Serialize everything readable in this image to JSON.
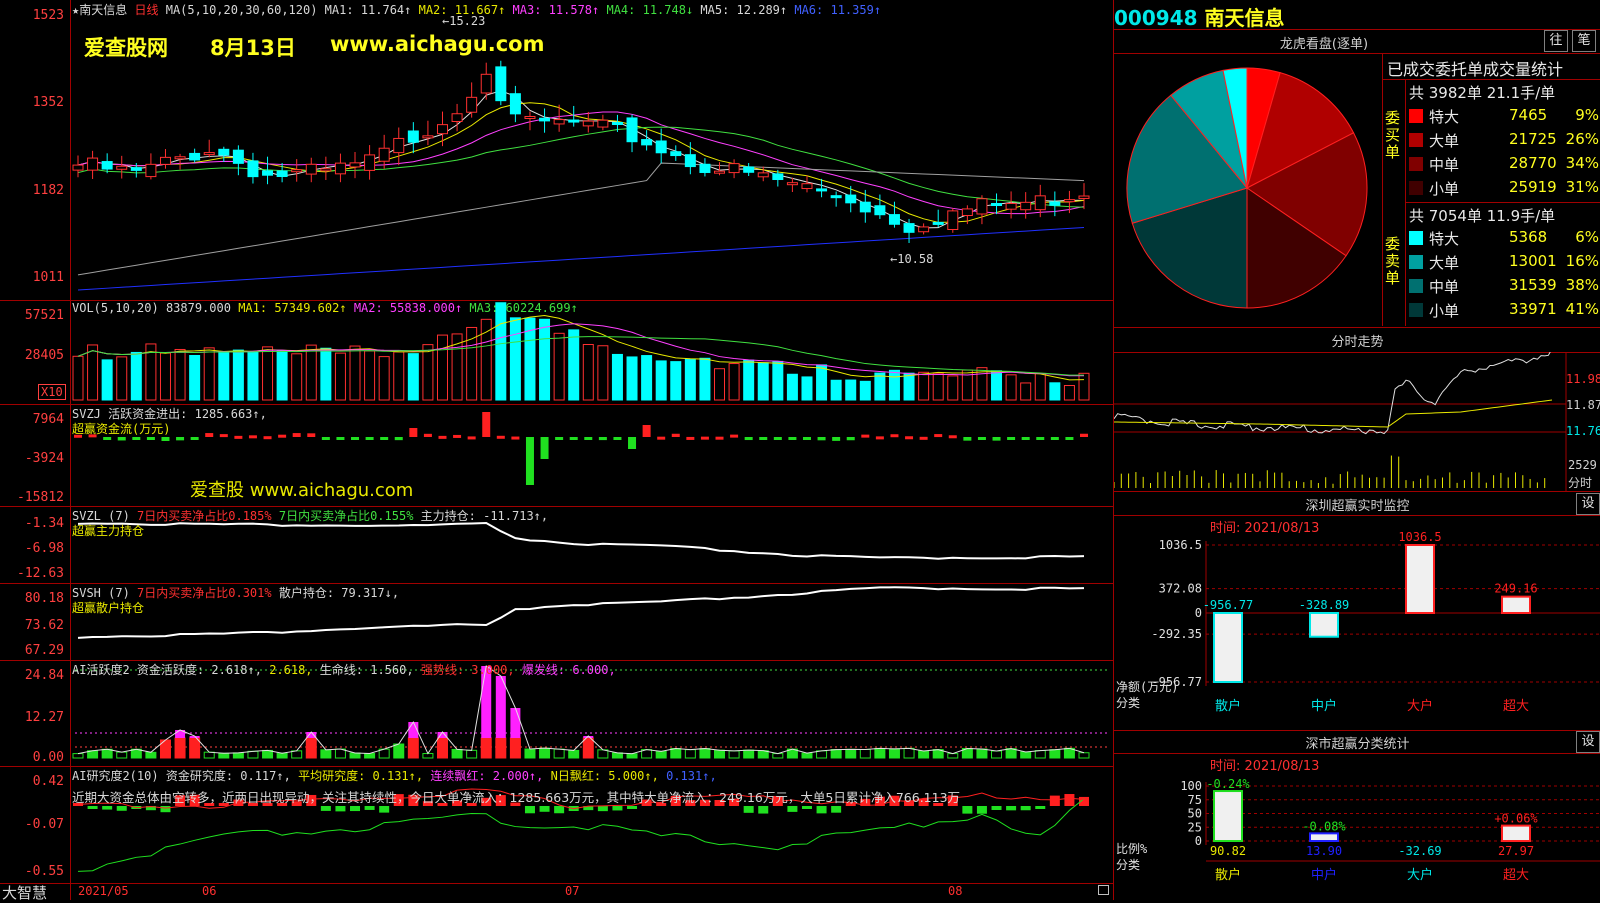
{
  "watermark": {
    "site": "爱查股网",
    "date": "8月13日",
    "url": "www.aichagu.com",
    "mid_text": "爱查股 www.aichagu.com"
  },
  "main": {
    "title": "★南天信息",
    "period": "日线",
    "ma_params": "MA(5,10,20,30,60,120)",
    "ma1": "MA1: 11.764↑",
    "ma2": "MA2: 11.667↑",
    "ma3": "MA3: 11.578↑",
    "ma4": "MA4: 11.748↓",
    "ma5": "MA5: 12.289↑",
    "ma6": "MA6: 11.359↑",
    "yticks": [
      "1523",
      "1352",
      "1182",
      "1011"
    ],
    "high_mark": "←15.23",
    "low_mark": "←10.58"
  },
  "vol": {
    "title": "VOL(5,10,20)",
    "value": "83879.000",
    "ma1": "MA1: 57349.602↑",
    "ma2": "MA2: 55838.000↑",
    "ma3": "MA3: 60224.699↑",
    "yticks": [
      "57521",
      "28405"
    ],
    "unit": "X10"
  },
  "svzj": {
    "title": "SVZJ",
    "label": "活跃资金进出: 1285.663↑,",
    "sub": "超赢资金流(万元)",
    "yticks": [
      "7964",
      "-3924",
      "-15812"
    ]
  },
  "svzl": {
    "title": "SVZL (7)",
    "t1": "7日内买卖净占比0.185%",
    "t2": "7日内买卖净占比0.155%",
    "t3": "主力持仓: -11.713↑,",
    "sub": "超赢主力持仓",
    "yticks": [
      "-1.34",
      "-6.98",
      "-12.63"
    ]
  },
  "svsh": {
    "title": "SVSH (7)",
    "t1": "7日内买卖净占比0.301%",
    "t2": "散户持仓: 79.317↓,",
    "sub": "超赢散户持仓",
    "yticks": [
      "80.18",
      "73.62",
      "67.29"
    ]
  },
  "ai1": {
    "title": "AI活跃度2",
    "t1": "资金活跃度: 2.618↑,",
    "t2": "2.618,",
    "t3": "生命线: 1.560,",
    "t4": "强势线: 3.000,",
    "t5": "爆发线: 6.000,",
    "yticks": [
      "24.84",
      "12.27",
      "0.00"
    ]
  },
  "ai2": {
    "title": "AI研究度2(10)",
    "t1": "资金研究度: 0.117↑,",
    "t2": "平均研究度: 0.131↑,",
    "t3": "连续飘红: 2.000↑,",
    "t4": "N日飘红: 5.000↑,",
    "t5": "0.131↑,",
    "comment": "近期大资金总体由空转多，近两日出现异动，关注其持续性，今日大单净流入：1285.663万元，其中特大单净流入：249.16万元，大单5日累计净入766.113万",
    "yticks": [
      "0.42",
      "-0.07",
      "-0.55"
    ]
  },
  "footer": {
    "brand": "大智慧",
    "dates": [
      "2021/05",
      "06",
      "07",
      "08"
    ]
  },
  "stock": {
    "code": "000948",
    "name": "南天信息"
  },
  "dragon": {
    "title": "龙虎看盘(逐单)",
    "btn1": "往",
    "btn2": "笔",
    "stats_title": "已成交委托单成交量统计",
    "buy": {
      "label": "委买单",
      "total": "共 3982单 21.1手/单",
      "rows": [
        {
          "name": "特大",
          "val": "7465",
          "pct": "9%",
          "color": "#ff0000"
        },
        {
          "name": "大单",
          "val": "21725",
          "pct": "26%",
          "color": "#b00000"
        },
        {
          "name": "中单",
          "val": "28770",
          "pct": "34%",
          "color": "#800000"
        },
        {
          "name": "小单",
          "val": "25919",
          "pct": "31%",
          "color": "#400000"
        }
      ]
    },
    "sell": {
      "label": "委卖单",
      "total": "共 7054单 11.9手/单",
      "rows": [
        {
          "name": "特大",
          "val": "5368",
          "pct": "6%",
          "color": "#00ffff"
        },
        {
          "name": "大单",
          "val": "13001",
          "pct": "16%",
          "color": "#00a0a0"
        },
        {
          "name": "中单",
          "val": "31539",
          "pct": "38%",
          "color": "#007070"
        },
        {
          "name": "小单",
          "val": "33971",
          "pct": "41%",
          "color": "#003838"
        }
      ]
    }
  },
  "intraday": {
    "title": "分时走势",
    "yticks": [
      "11.98",
      "11.87",
      "11.76"
    ],
    "vol": "2529",
    "vol_unit": "分时"
  },
  "monitor": {
    "title": "深圳超赢实时监控",
    "btn": "设",
    "time": "时间: 2021/08/13",
    "yticks": [
      "1036.5",
      "372.08",
      "0",
      "-292.35",
      "-956.77"
    ],
    "ylabel": "净额(万元)",
    "xlabel": "分类",
    "bars": [
      {
        "cat": "散户",
        "value": -956.77,
        "label": "-956.77"
      },
      {
        "cat": "中户",
        "value": -328.89,
        "label": "-328.89"
      },
      {
        "cat": "大户",
        "value": 1036.5,
        "label": "1036.5"
      },
      {
        "cat": "超大",
        "value": 249.16,
        "label": "249.16"
      }
    ]
  },
  "classify": {
    "title": "深市超赢分类统计",
    "btn": "设",
    "time": "时间: 2021/08/13",
    "yticks": [
      "100",
      "75",
      "50",
      "25",
      "0"
    ],
    "ylabel": "比例%",
    "xlabel": "分类",
    "bars": [
      {
        "cat": "散户",
        "value": 90.82,
        "top": "-0.24%",
        "bottom": "90.82"
      },
      {
        "cat": "中户",
        "value": 13.9,
        "top": "-0.08%",
        "bottom": "13.90"
      },
      {
        "cat": "大户",
        "value": -32.69,
        "top": "",
        "bottom": "-32.69"
      },
      {
        "cat": "超大",
        "value": 27.97,
        "top": "+0.06%",
        "bottom": "27.97"
      }
    ]
  }
}
